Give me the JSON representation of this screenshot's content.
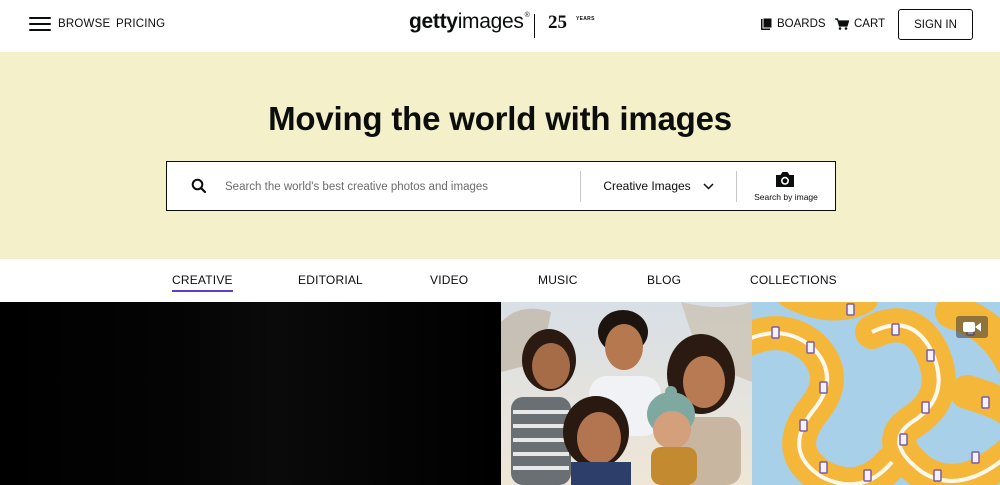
{
  "header": {
    "menu_icon": "hamburger-menu-icon",
    "browse_label": "BROWSE",
    "pricing_label": "PRICING",
    "logo": {
      "part1": "getty",
      "part2": "images",
      "reg": "®",
      "anniversary_number": "25",
      "anniversary_word": "YEARS"
    },
    "boards_label": "BOARDS",
    "boards_icon": "boards-icon",
    "cart_label": "CART",
    "cart_icon": "cart-icon",
    "signin_label": "SIGN IN"
  },
  "hero": {
    "title": "Moving the world with images",
    "search": {
      "placeholder": "Search the world's best creative photos and images",
      "value": "",
      "icon": "search-icon",
      "dropdown_value": "Creative Images",
      "dropdown_icon": "chevron-down-icon",
      "search_by_image_label": "Search by image",
      "camera_icon": "camera-icon"
    },
    "background_color": "#f4f0c9"
  },
  "tabs": [
    {
      "label": "CREATIVE",
      "active": true
    },
    {
      "label": "EDITORIAL",
      "active": false
    },
    {
      "label": "VIDEO",
      "active": false
    },
    {
      "label": "MUSIC",
      "active": false
    },
    {
      "label": "BLOG",
      "active": false
    },
    {
      "label": "COLLECTIONS",
      "active": false
    }
  ],
  "accent_color": "#5f3fc9",
  "gallery": {
    "tiles": [
      {
        "kind": "video-still",
        "description_icon": "dark-video-frame"
      },
      {
        "kind": "photo",
        "description_icon": "family-photo"
      },
      {
        "kind": "video",
        "description_icon": "film-canister-track",
        "badge_icon": "video-camera-icon"
      }
    ]
  }
}
